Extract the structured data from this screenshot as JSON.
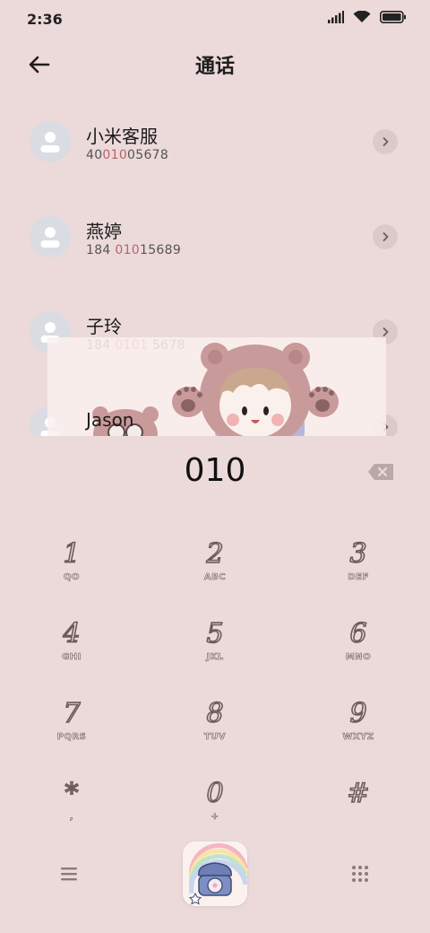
{
  "status": {
    "time": "2:36",
    "icons": [
      "signal-icon",
      "wifi-icon",
      "battery-icon"
    ]
  },
  "header": {
    "back_icon": "arrow-left-icon",
    "title": "通话"
  },
  "contacts": [
    {
      "name": "小米客服",
      "number_pre": "40",
      "number_hl": "010",
      "number_post": "05678"
    },
    {
      "name": "燕婷",
      "number_pre": "184 ",
      "number_hl": "010",
      "number_post": "15689"
    },
    {
      "name": "子玲",
      "number_pre": "184 ",
      "number_hl": "0101",
      "number_post": " 5678"
    },
    {
      "name": "Jason",
      "number_pre": "",
      "number_hl": "",
      "number_post": ""
    }
  ],
  "dialer": {
    "number": "010",
    "backspace_icon": "backspace-icon"
  },
  "keypad": {
    "keys": [
      {
        "digit": "1",
        "letters": "QO"
      },
      {
        "digit": "2",
        "letters": "ABC"
      },
      {
        "digit": "3",
        "letters": "DEF"
      },
      {
        "digit": "4",
        "letters": "GHI"
      },
      {
        "digit": "5",
        "letters": "JKL"
      },
      {
        "digit": "6",
        "letters": "MNO"
      },
      {
        "digit": "7",
        "letters": "PQRS"
      },
      {
        "digit": "8",
        "letters": "TUV"
      },
      {
        "digit": "9",
        "letters": "WXYZ"
      },
      {
        "digit": "*",
        "letters": ","
      },
      {
        "digit": "0",
        "letters": "+"
      },
      {
        "digit": "#",
        "letters": ""
      }
    ]
  },
  "bottom": {
    "menu_icon": "menu-icon",
    "call_icon": "telephone-call-icon",
    "keypad_icon": "dialpad-icon"
  },
  "colors": {
    "background": "#ecd9d9",
    "highlight": "#b7656c",
    "avatar_bg": "#d9dce2"
  }
}
